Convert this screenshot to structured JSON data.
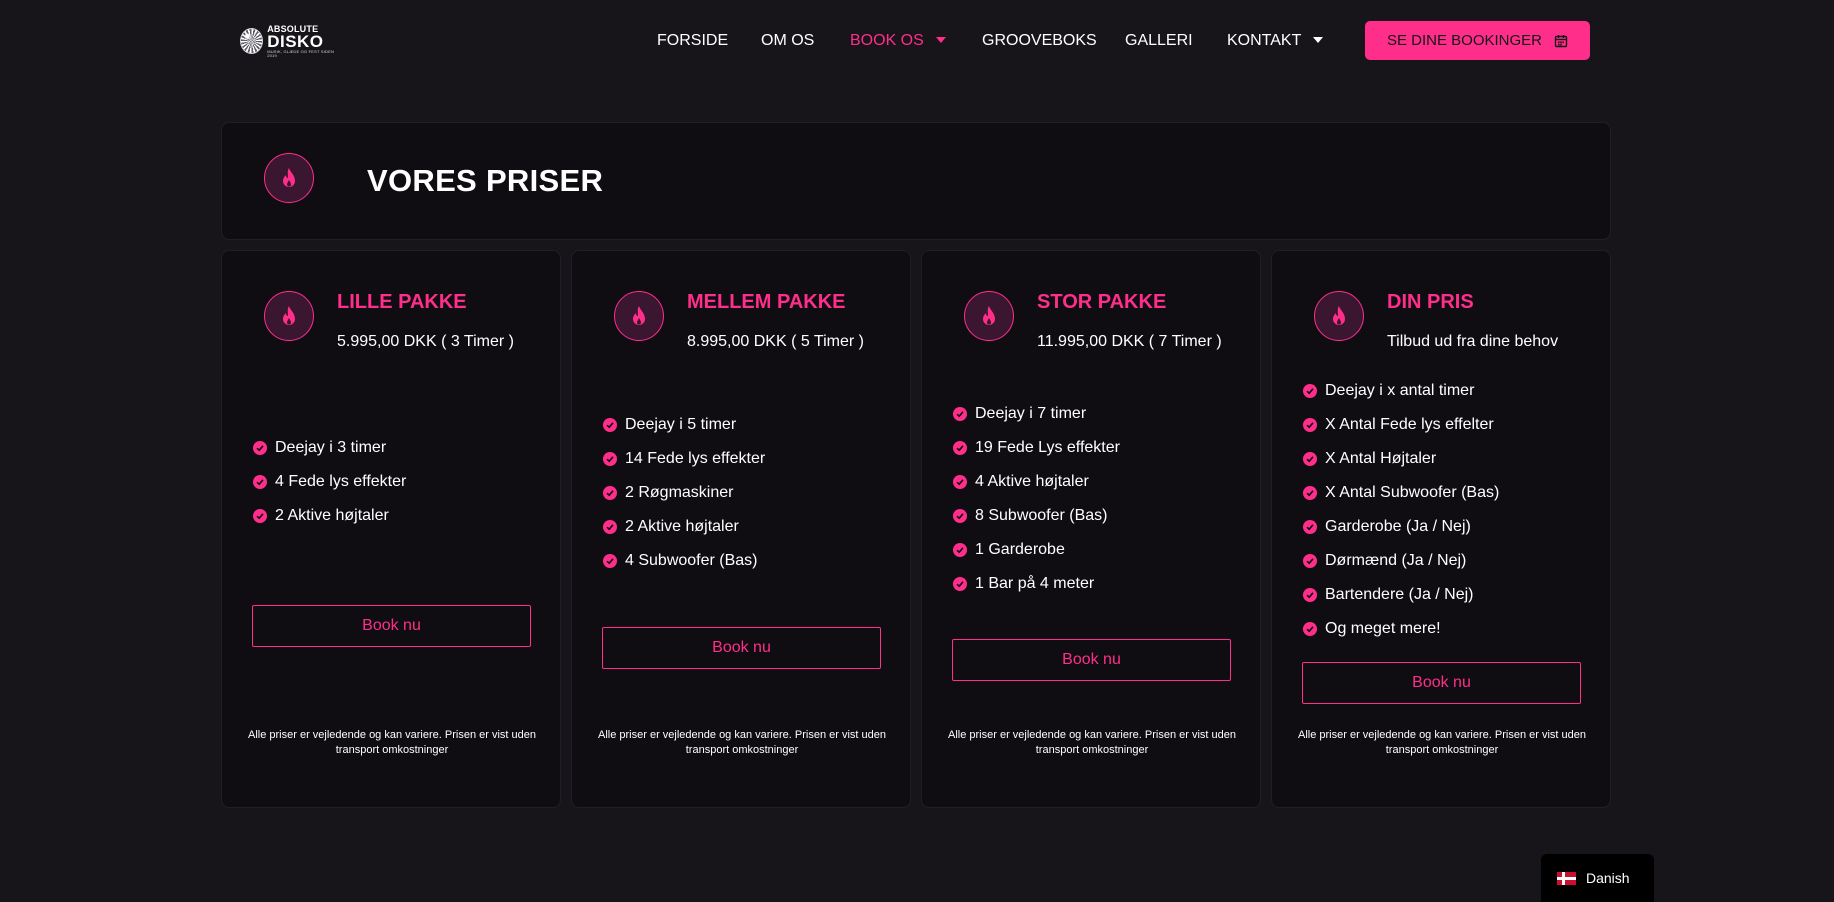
{
  "logo": {
    "top": "ABSOLUTE",
    "main": "DISKO",
    "tagline": "MUSIK, GLÆDE OG FEST SIDEN 2019"
  },
  "nav": {
    "items": [
      {
        "label": "FORSIDE",
        "dropdown": false,
        "active": false
      },
      {
        "label": "OM OS",
        "dropdown": false,
        "active": false
      },
      {
        "label": "BOOK OS",
        "dropdown": true,
        "active": true
      },
      {
        "label": "GROOVEBOKS",
        "dropdown": false,
        "active": false
      },
      {
        "label": "GALLERI",
        "dropdown": false,
        "active": false
      },
      {
        "label": "KONTAKT",
        "dropdown": true,
        "active": false
      }
    ],
    "cta_label": "SE DINE BOOKINGER",
    "cta_icon": "calendar-icon"
  },
  "title": "VORES PRISER",
  "packages": [
    {
      "name": "LILLE PAKKE",
      "price": "5.995,00 DKK ( 3 Timer )",
      "features": [
        "Deejay i 3 timer",
        "4 Fede lys effekter",
        "2 Aktive højtaler"
      ],
      "button": "Book nu",
      "disclaimer": "Alle priser er vejledende og kan variere. Prisen er vist uden transport omkostninger"
    },
    {
      "name": "MELLEM PAKKE",
      "price": "8.995,00  DKK ( 5 Timer )",
      "features": [
        "Deejay i 5 timer",
        "14 Fede lys effekter",
        "2 Røgmaskiner",
        "2 Aktive højtaler",
        "4 Subwoofer (Bas)"
      ],
      "button": "Book nu",
      "disclaimer": "Alle priser er vejledende og kan variere. Prisen er vist uden transport omkostninger"
    },
    {
      "name": "STOR PAKKE",
      "price": "11.995,00 DKK ( 7 Timer )",
      "features": [
        "Deejay i 7 timer",
        "19 Fede Lys effekter",
        "4 Aktive højtaler",
        "8 Subwoofer (Bas)",
        "1 Garderobe",
        "1 Bar på 4 meter"
      ],
      "button": "Book nu",
      "disclaimer": "Alle priser er vejledende og kan variere. Prisen er vist uden transport omkostninger"
    },
    {
      "name": "DIN PRIS",
      "price": "Tilbud ud fra dine behov",
      "features": [
        "Deejay i x antal timer",
        "X Antal Fede lys effelter",
        "X Antal Højtaler",
        "X Antal Subwoofer (Bas)",
        "Garderobe (Ja / Nej)",
        "Dørmænd (Ja / Nej)",
        "Bartendere (Ja / Nej)",
        "Og meget mere!"
      ],
      "button": "Book nu",
      "disclaimer": "Alle priser er vejledende og kan variere. Prisen er vist uden transport omkostninger"
    }
  ],
  "language": {
    "label": "Danish",
    "flag": "danish-flag-icon"
  },
  "colors": {
    "accent": "#ff2e8a",
    "background": "#17141a",
    "card": "#0f0d12"
  }
}
